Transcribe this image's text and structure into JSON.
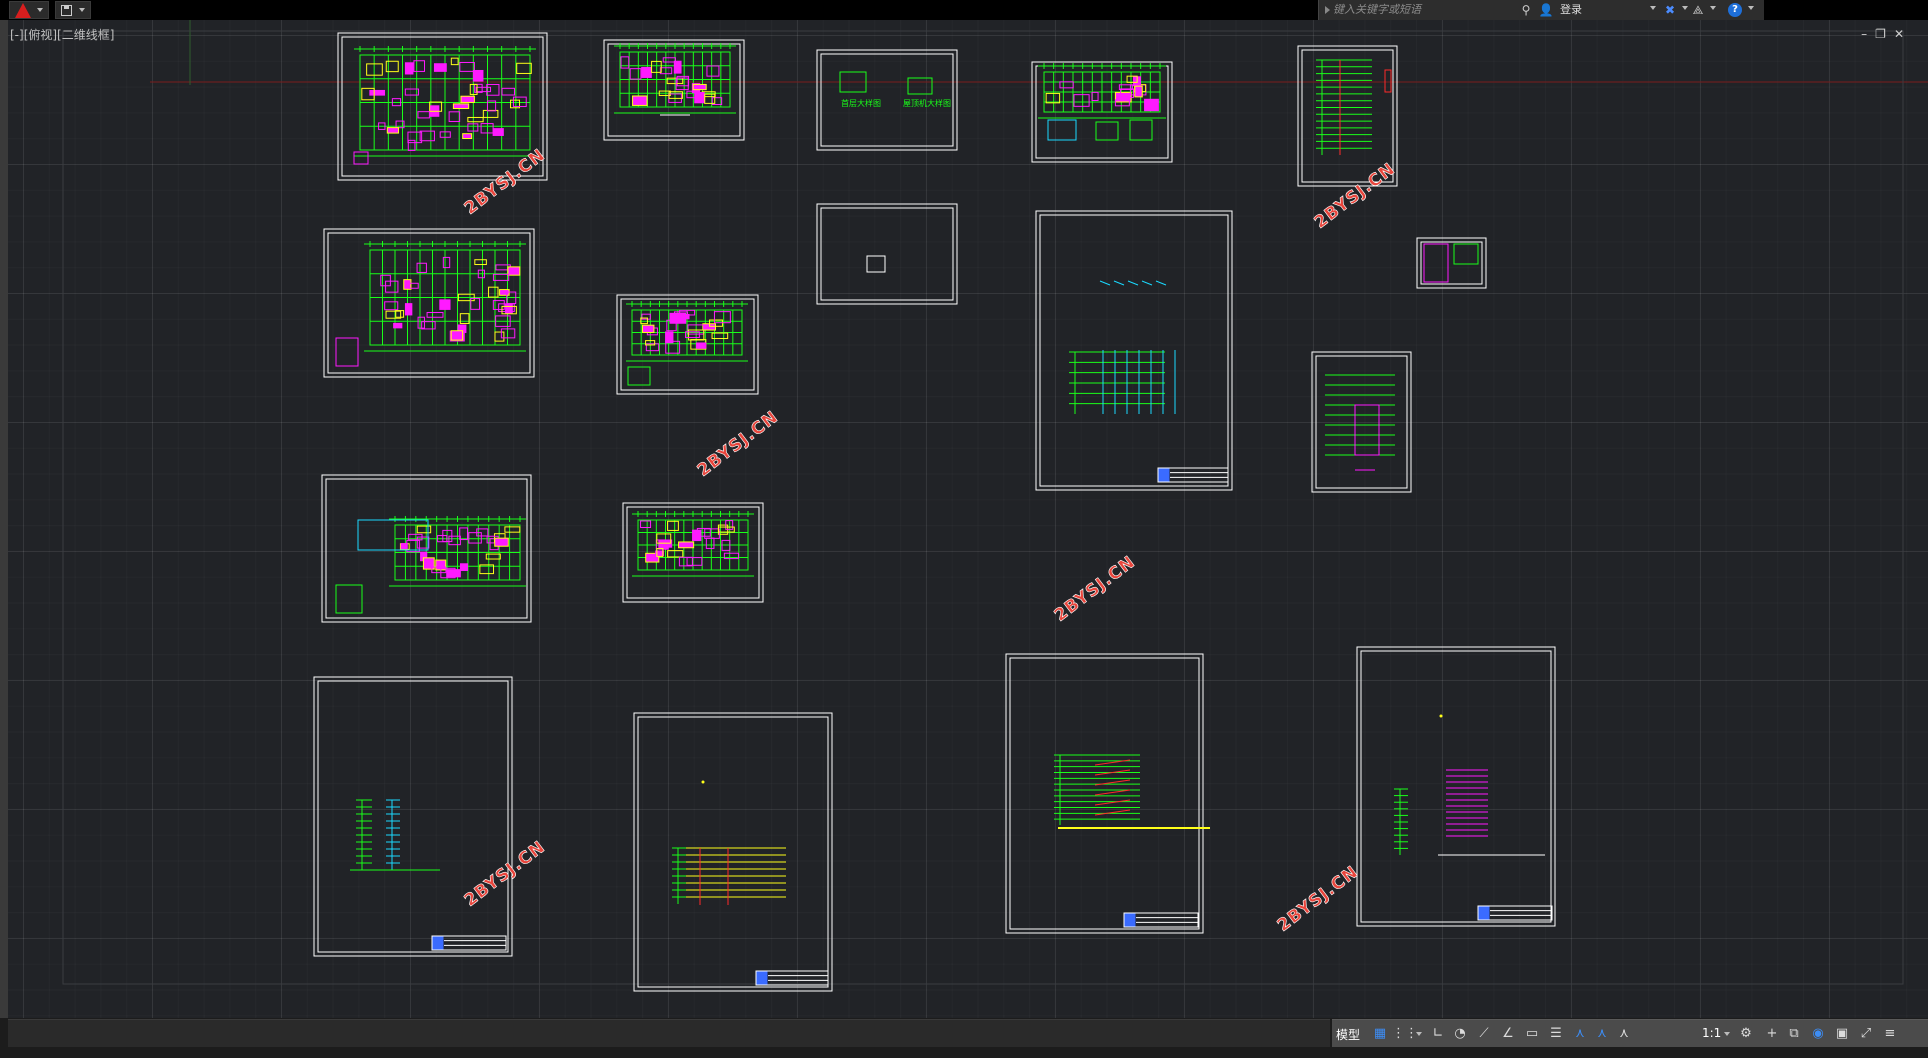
{
  "titlebar": {
    "app_menu_icon": "autocad-logo-icon",
    "quick_access_icon": "save-icon",
    "search_placeholder": "键入关键字或短语",
    "search_icon": "binoculars-icon",
    "user_icon": "user-icon",
    "login_label": "登录",
    "exchange_icon": "exchange-x-icon",
    "a360_icon": "triangle-connect-icon",
    "help_icon": "help-icon",
    "help_glyph": "?"
  },
  "viewport": {
    "view_label": "[-][俯视][二维线框]",
    "background_color": "#212327",
    "window_controls": [
      "minimize-icon",
      "restore-icon",
      "close-icon"
    ],
    "window_control_glyphs": [
      "–",
      "❐",
      "✕"
    ],
    "watermark_text": "2BYSJ.CN",
    "watermark_color": "#e8453c",
    "sheet_border_color": "#ffffff",
    "line_colors": {
      "green": "#19ff19",
      "magenta": "#ff1aff",
      "cyan": "#1ad9ff",
      "yellow": "#ffff1a",
      "red": "#ff2a2a",
      "white": "#ffffff",
      "blue": "#3a6bff"
    },
    "sheet_texts": [
      "首层大样图",
      "屋顶机大样图"
    ]
  },
  "statusbar": {
    "model_label": "模型",
    "scale_label": "1:1",
    "icons": [
      "grid-icon",
      "snap-icon",
      "ortho-icon",
      "polar-icon",
      "isodraft-icon",
      "osnap-icon",
      "lineweight-icon",
      "annotation-visibility-icon",
      "autoscale-icon",
      "annotation-scale-icon",
      "workspace-gear-icon",
      "plus-icon",
      "isolate-icon",
      "hardware-accel-icon",
      "clean-screen-icon",
      "customize-menu-icon"
    ]
  }
}
